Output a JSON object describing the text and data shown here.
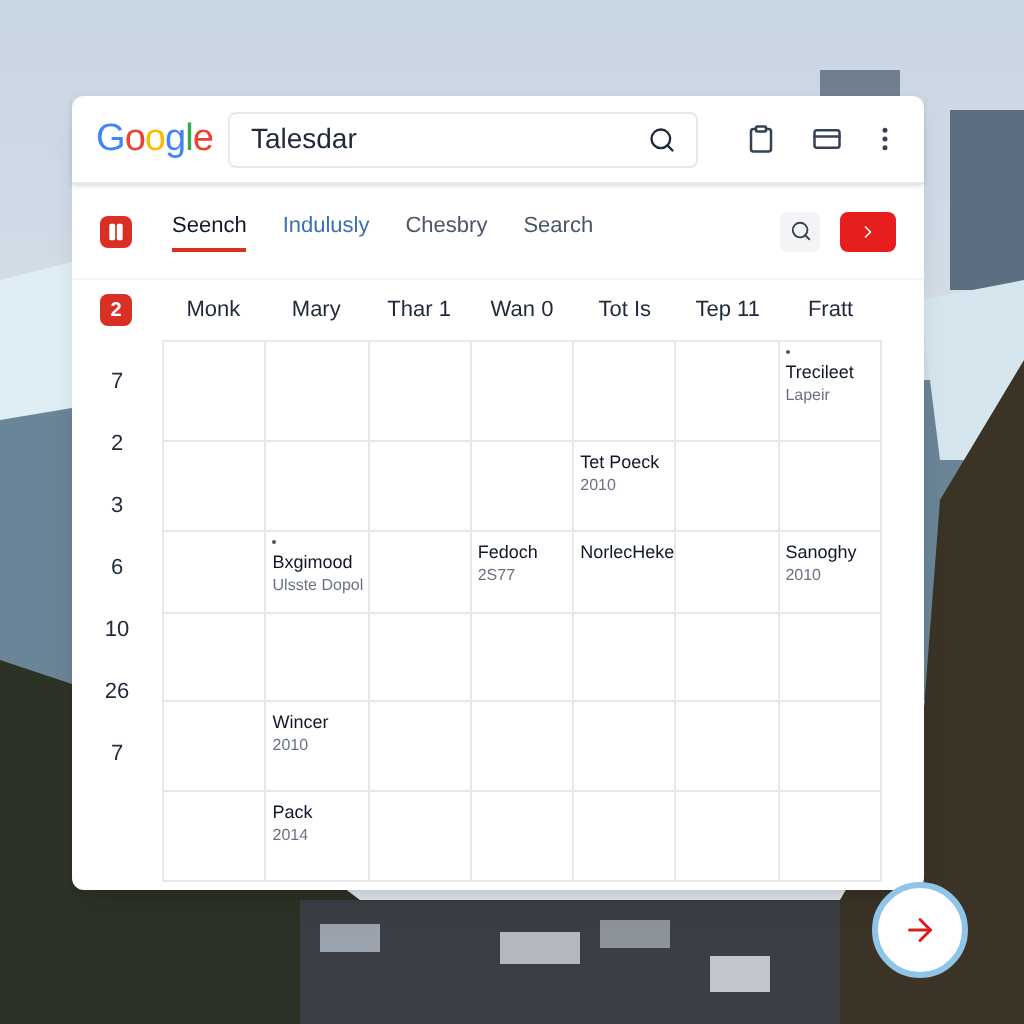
{
  "header": {
    "logo": "Google",
    "search_value": "Talesdar"
  },
  "tabs": [
    {
      "label": "Seench",
      "selected": true,
      "highlighted": false
    },
    {
      "label": "Indulusly",
      "selected": false,
      "highlighted": true
    },
    {
      "label": "Chesbry",
      "selected": false,
      "highlighted": false
    },
    {
      "label": "Search",
      "selected": false,
      "highlighted": false
    }
  ],
  "week_badge": "2",
  "days": [
    "Monk",
    "Mary",
    "Thar 1",
    "Wan 0",
    "Tot Is",
    "Tep 11",
    "Fratt"
  ],
  "hours": [
    "7",
    "2",
    "3",
    "6",
    "10",
    "26",
    "7"
  ],
  "grid": {
    "rows": [
      {
        "cells": [
          null,
          null,
          null,
          null,
          null,
          null,
          {
            "title": "Trecileet",
            "subtitle": "Lapeir",
            "dot": true
          }
        ]
      },
      {
        "cells": [
          null,
          null,
          null,
          null,
          {
            "title": "Tet Poeck",
            "subtitle": "2010",
            "dot": false
          },
          null,
          null
        ]
      },
      {
        "cells": [
          null,
          {
            "title": "Bxgimood",
            "subtitle": "Ulsste Dopol",
            "dot": true
          },
          null,
          {
            "title": "Fedoch",
            "subtitle": "2S77",
            "dot": false
          },
          {
            "title": "NorlecHeke",
            "dot": false
          },
          null,
          {
            "title": "Sanoghy",
            "subtitle": "2010",
            "dot": false
          }
        ]
      },
      {
        "cells": [
          null,
          null,
          null,
          null,
          null,
          null,
          null
        ]
      },
      {
        "cells": [
          null,
          {
            "title": "Wincer",
            "subtitle": "2010",
            "dot": false
          },
          null,
          null,
          null,
          null,
          null
        ]
      },
      {
        "cells": [
          null,
          {
            "title": "Pack",
            "subtitle": "2014",
            "dot": false
          },
          null,
          null,
          null,
          null,
          null
        ]
      }
    ]
  }
}
